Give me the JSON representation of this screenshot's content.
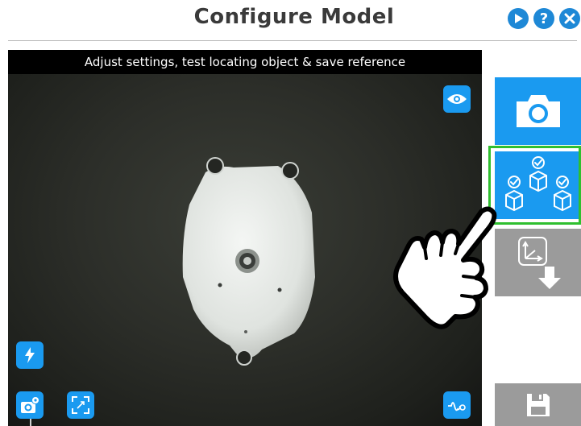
{
  "header": {
    "title": "Configure Model",
    "buttons": [
      {
        "name": "play",
        "glyph": "▶"
      },
      {
        "name": "help",
        "glyph": "?"
      },
      {
        "name": "close",
        "glyph": "✕"
      }
    ]
  },
  "camera": {
    "banner": "Adjust settings, test locating object & save reference",
    "icons": [
      "eye-icon",
      "flash-icon",
      "camera-settings-icon",
      "zoom-fit-icon",
      "waveform-icon"
    ]
  },
  "side_panel": {
    "buttons": [
      {
        "name": "camera",
        "icon": "camera-icon",
        "color": "#1a9af0"
      },
      {
        "name": "test-locate",
        "icon": "cubes-check-icon",
        "color": "#1a9af0",
        "selected": true
      },
      {
        "name": "save-reference-frame",
        "icon": "axes-download-icon",
        "color": "#9b9b9b"
      },
      {
        "name": "save",
        "icon": "floppy-icon",
        "color": "#9b9b9b"
      }
    ]
  },
  "colors": {
    "accent": "#1a9af0",
    "selected_border": "#2fbf2f",
    "disabled": "#9b9b9b",
    "title": "#3a3a3a"
  }
}
